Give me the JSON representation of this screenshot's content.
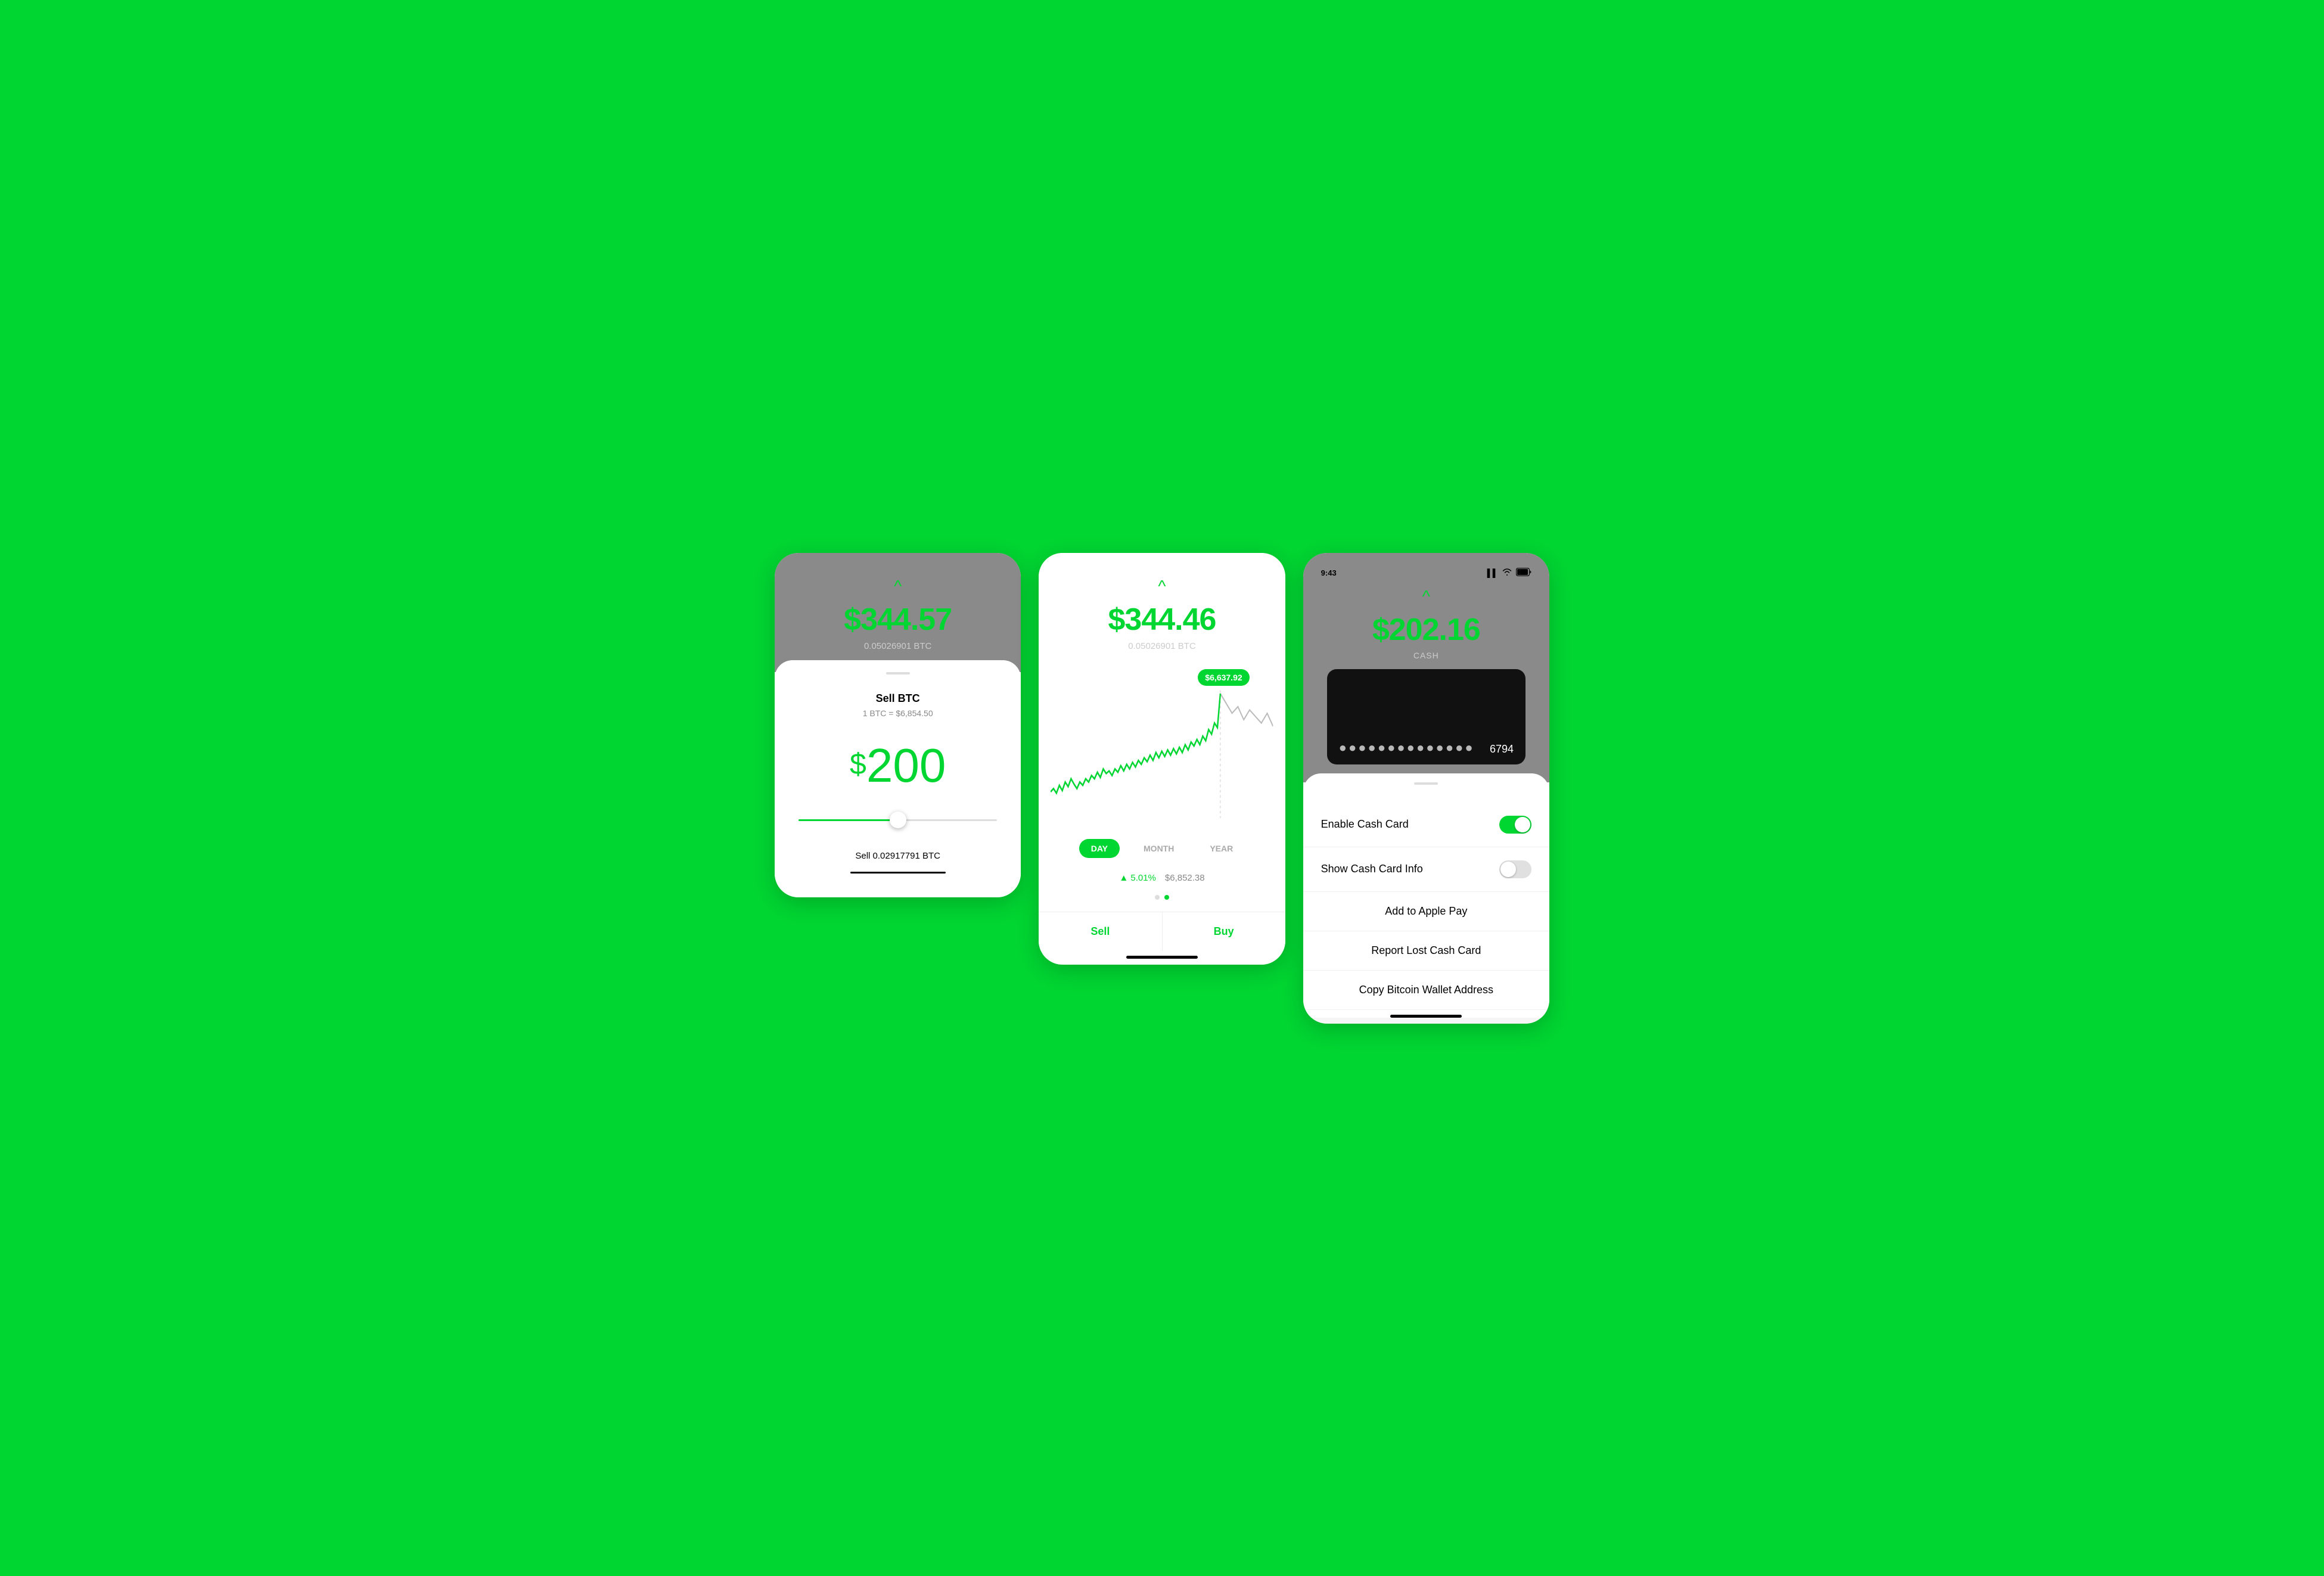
{
  "screen1": {
    "top": {
      "chevron": "^",
      "price": "$344.57",
      "btc_amount": "0.05026901 BTC"
    },
    "sell_title": "Sell BTC",
    "sell_rate": "1 BTC = $6,854.50",
    "sell_amount_dollar": "$",
    "sell_amount_number": "200",
    "sell_btc_label": "Sell 0.02917791 BTC"
  },
  "screen2": {
    "top": {
      "chevron": "^",
      "price": "$344.46",
      "btc_amount": "0.05026901 BTC"
    },
    "tooltip_price": "$6,637.92",
    "time_buttons": [
      "DAY",
      "MONTH",
      "YEAR"
    ],
    "active_time": "DAY",
    "change_percent": "▲ 5.01%",
    "change_price": "$6,852.38",
    "sell_label": "Sell",
    "buy_label": "Buy"
  },
  "screen3": {
    "status_bar": {
      "time": "9:43",
      "location_icon": "▶",
      "signal": "●●●",
      "wifi": "wifi",
      "battery": "battery"
    },
    "top": {
      "chevron": "^",
      "price": "$202.16",
      "cash_label": "CASH"
    },
    "card": {
      "dots1": "●●●●",
      "dots2": "●●●●●",
      "dots3": "●●●●●",
      "last_digits": "6794"
    },
    "menu_items": [
      {
        "label": "Enable Cash Card",
        "type": "toggle",
        "state": "on"
      },
      {
        "label": "Show Cash Card Info",
        "type": "toggle",
        "state": "off"
      },
      {
        "label": "Add to Apple Pay",
        "type": "center"
      },
      {
        "label": "Report Lost Cash Card",
        "type": "center"
      },
      {
        "label": "Copy Bitcoin Wallet Address",
        "type": "center"
      }
    ]
  },
  "colors": {
    "green": "#00D632",
    "background": "#00D632",
    "gray_top": "#8A8A8A",
    "card_bg": "#111111"
  }
}
